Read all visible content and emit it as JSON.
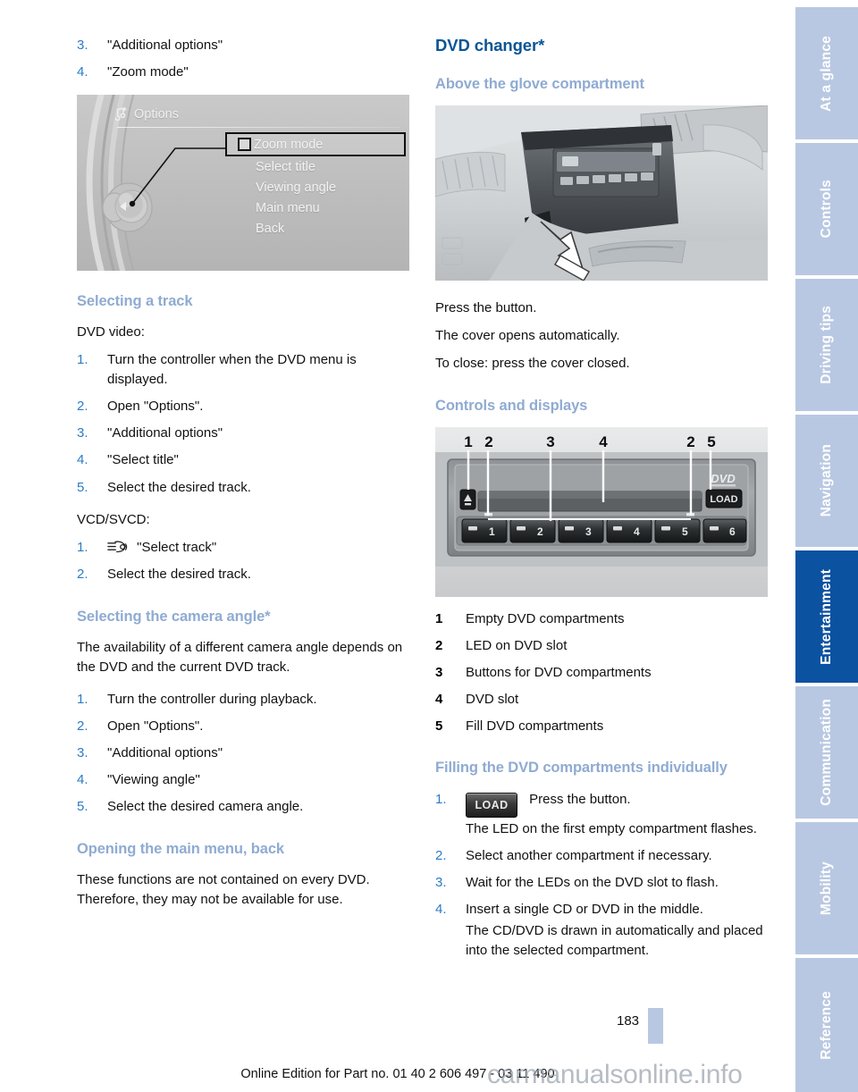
{
  "document": {
    "page_number": "183",
    "footer_line": "Online Edition for Part no. 01 40 2 606 497 - 03 11 490",
    "watermark": "carmanualsonline.info"
  },
  "colors": {
    "heading_primary": "#0a5596",
    "heading_secondary": "#8fabd2",
    "step_number": "#2a7cc7",
    "tab_inactive": "#b9c8e2",
    "tab_active": "#0b52a1",
    "text": "#111111"
  },
  "sidebar": {
    "tabs": [
      {
        "label": "At a glance",
        "active": false
      },
      {
        "label": "Controls",
        "active": false
      },
      {
        "label": "Driving tips",
        "active": false
      },
      {
        "label": "Navigation",
        "active": false
      },
      {
        "label": "Entertainment",
        "active": true
      },
      {
        "label": "Communication",
        "active": false
      },
      {
        "label": "Mobility",
        "active": false
      },
      {
        "label": "Reference",
        "active": false
      }
    ]
  },
  "left_column": {
    "continued_steps": [
      {
        "num": "3.",
        "text": "\"Additional options\""
      },
      {
        "num": "4.",
        "text": "\"Zoom mode\""
      }
    ],
    "idrive_figure": {
      "header_title": "Options",
      "header_icon": "options-note-icon",
      "menu_items": [
        {
          "label": "Zoom mode",
          "selected": true,
          "checkbox": true
        },
        {
          "label": "Select title",
          "selected": false,
          "checkbox": false
        },
        {
          "label": "Viewing angle",
          "selected": false,
          "checkbox": false
        },
        {
          "label": "Main menu",
          "selected": false,
          "checkbox": false
        },
        {
          "label": "Back",
          "selected": false,
          "checkbox": false
        }
      ]
    },
    "section_track": {
      "heading": "Selecting a track",
      "intro_dvd": "DVD video:",
      "dvd_steps": [
        {
          "num": "1.",
          "text": "Turn the controller when the DVD menu is displayed."
        },
        {
          "num": "2.",
          "text": "Open \"Options\"."
        },
        {
          "num": "3.",
          "text": "\"Additional options\""
        },
        {
          "num": "4.",
          "text": "\"Select title\""
        },
        {
          "num": "5.",
          "text": "Select the desired track."
        }
      ],
      "intro_vcd": "VCD/SVCD:",
      "vcd_steps": [
        {
          "num": "1.",
          "text": "\"Select track\"",
          "icon": "idrive-list-icon"
        },
        {
          "num": "2.",
          "text": "Select the desired track.",
          "icon": ""
        }
      ]
    },
    "section_camera": {
      "heading": "Selecting the camera angle*",
      "body": "The availability of a different camera angle depends on the DVD and the current DVD track.",
      "steps": [
        {
          "num": "1.",
          "text": "Turn the controller during playback."
        },
        {
          "num": "2.",
          "text": "Open \"Options\"."
        },
        {
          "num": "3.",
          "text": "\"Additional options\""
        },
        {
          "num": "4.",
          "text": "\"Viewing angle\""
        },
        {
          "num": "5.",
          "text": "Select the desired camera angle."
        }
      ]
    },
    "section_mainmenu": {
      "heading": "Opening the main menu, back",
      "body": "These functions are not contained on every DVD. Therefore, they may not be available for use."
    }
  },
  "right_column": {
    "title": "DVD changer*",
    "section_glove": {
      "heading": "Above the glove compartment",
      "lines": [
        "Press the button.",
        "The cover opens automatically.",
        "To close: press the cover closed."
      ]
    },
    "section_controls": {
      "heading": "Controls and displays",
      "callout_labels_top": [
        "1",
        "2",
        "3",
        "4",
        "2",
        "5"
      ],
      "changer_buttons": [
        "1",
        "2",
        "3",
        "4",
        "5",
        "6"
      ],
      "load_button_label": "LOAD",
      "disc_logo": "DVD",
      "legend": [
        {
          "num": "1",
          "text": "Empty DVD compartments"
        },
        {
          "num": "2",
          "text": "LED on DVD slot"
        },
        {
          "num": "3",
          "text": "Buttons for DVD compartments"
        },
        {
          "num": "4",
          "text": "DVD slot"
        },
        {
          "num": "5",
          "text": "Fill DVD compartments"
        }
      ]
    },
    "section_filling": {
      "heading": "Filling the DVD compartments individually",
      "steps": [
        {
          "num": "1.",
          "button": "LOAD",
          "text": "Press the button.",
          "sub": "The LED on the first empty compartment flashes."
        },
        {
          "num": "2.",
          "button": "",
          "text": "Select another compartment if necessary.",
          "sub": ""
        },
        {
          "num": "3.",
          "button": "",
          "text": "Wait for the LEDs on the DVD slot to flash.",
          "sub": ""
        },
        {
          "num": "4.",
          "button": "",
          "text": "Insert a single CD or DVD in the middle.",
          "sub": "The CD/DVD is drawn in automatically and placed into the selected compartment."
        }
      ]
    }
  }
}
